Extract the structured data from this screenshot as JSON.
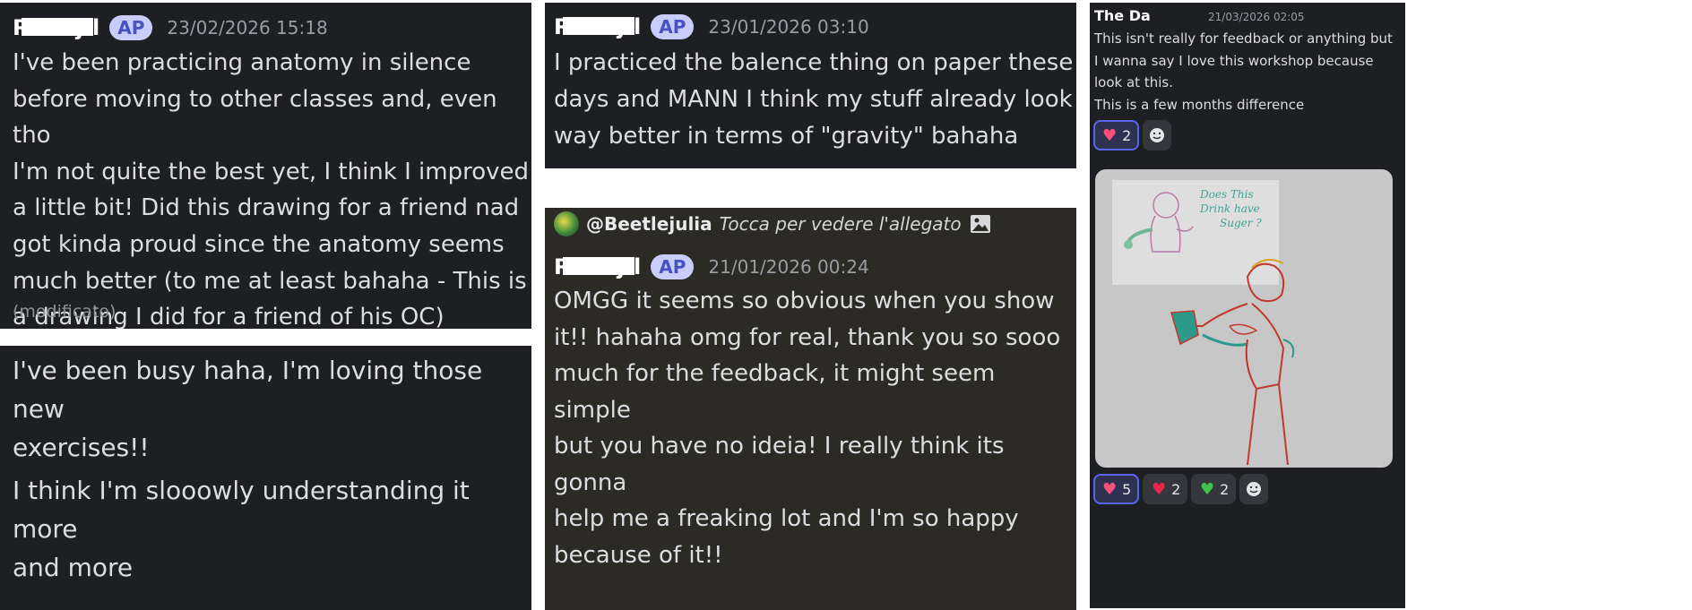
{
  "panel1": {
    "username": "Ravejil",
    "badge": "AP",
    "timestamp": "23/02/2026 15:18",
    "lines": [
      "I've been practicing anatomy in silence",
      "before moving to other classes and, even tho",
      "I'm not quite the best yet, I think I improved",
      "a little bit! Did this drawing for a friend nad",
      "got kinda proud since the anatomy seems",
      "much better (to me at least bahaha - This is",
      "a drawing I did for a friend of his OC)"
    ],
    "edited": "(modificato)"
  },
  "panel2": {
    "lines": [
      "I've been busy haha, I'm loving those new",
      "exercises!!",
      "I think I'm slooowly understanding it more",
      "and more"
    ]
  },
  "panel3": {
    "username": "Ravejil",
    "badge": "AP",
    "timestamp": "23/01/2026 03:10",
    "lines": [
      "I practiced the balence thing on paper these",
      "days and MANN I think my stuff already look",
      "way better in terms of \"gravity\" bahaha"
    ]
  },
  "panel4": {
    "reply_user": "@Beetlejulia",
    "reply_text": "Tocca per vedere l'allegato",
    "username": "Ravejil",
    "badge": "AP",
    "timestamp": "21/01/2026 00:24",
    "lines": [
      "OMGG it seems so obvious when you show",
      "it!! hahaha omg for real, thank you so sooo",
      "much for the feedback, it might seem simple",
      "but you have no ideia! I really think its gonna",
      "help me a freaking lot and I'm so happy",
      "because of it!!"
    ]
  },
  "panel5": {
    "username": "The Da",
    "timestamp": "21/03/2026 02:05",
    "lines": [
      "This isn't really for feedback or anything but",
      "I wanna say I love this workshop because",
      "look at this.",
      "This is a few months difference"
    ],
    "reaction_top": {
      "icon": "sparkling-heart-icon",
      "count": "2"
    },
    "sketch_text": [
      "Does This",
      "Drink have",
      "Suger ?"
    ],
    "reactions_bottom": [
      {
        "icon": "sparkling-heart-icon",
        "count": "5"
      },
      {
        "icon": "red-heart-icon",
        "count": "2"
      },
      {
        "icon": "green-heart-icon",
        "count": "2"
      }
    ]
  },
  "colors": {
    "panel_bg": "#1e1f23",
    "panel4_bg": "#2b2a25",
    "badge_bg": "#c9cdfb",
    "badge_text": "#4752c4",
    "reaction_border": "#5865f2"
  }
}
